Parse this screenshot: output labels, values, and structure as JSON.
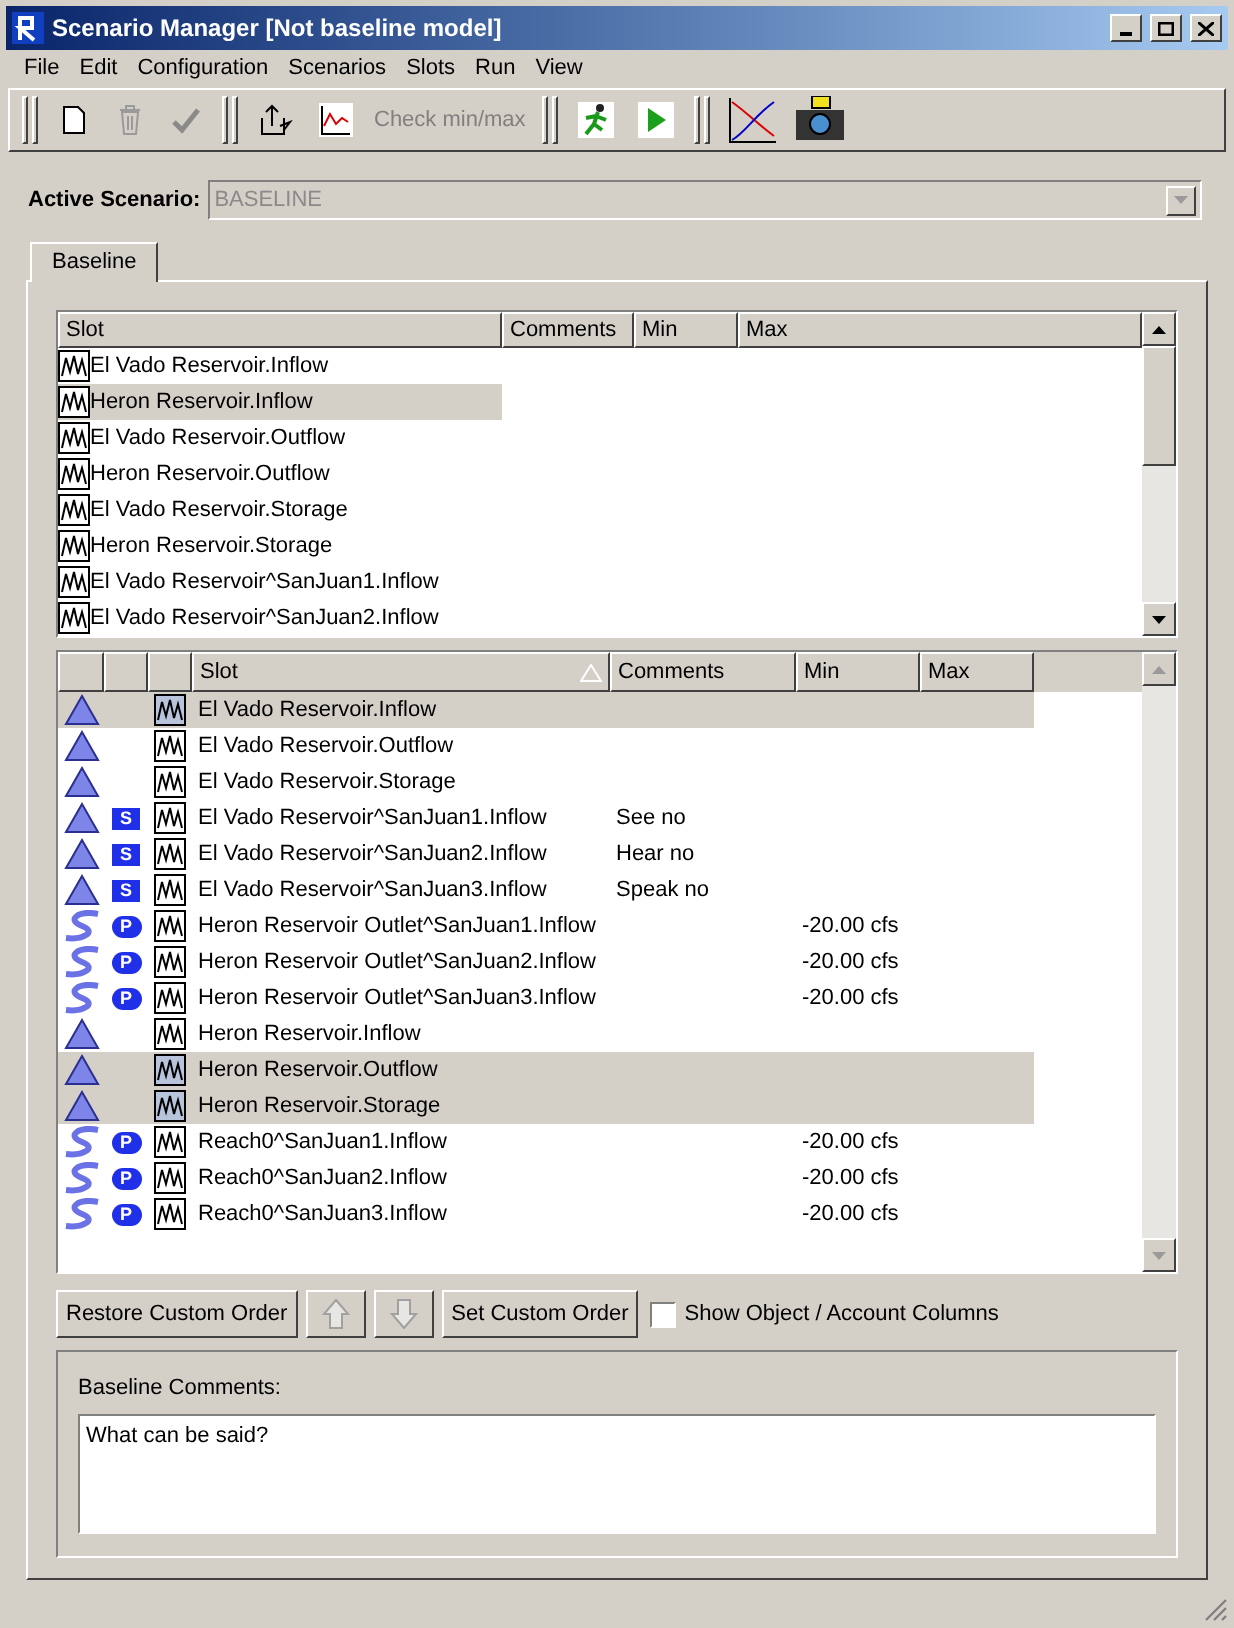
{
  "window": {
    "title": "Scenario Manager [Not baseline model]"
  },
  "menu": [
    "File",
    "Edit",
    "Configuration",
    "Scenarios",
    "Slots",
    "Run",
    "View"
  ],
  "toolbar": {
    "check_minmax": {
      "label": "Check min/max",
      "disabled": true
    }
  },
  "active_scenario": {
    "label": "Active Scenario:",
    "value": "BASELINE",
    "disabled": true
  },
  "tabs": [
    {
      "label": "Baseline",
      "selected": true
    }
  ],
  "top_table": {
    "columns": [
      "Slot",
      "Comments",
      "Min",
      "Max"
    ],
    "rows": [
      {
        "slot": "El Vado Reservoir.Inflow",
        "selected": false
      },
      {
        "slot": "Heron Reservoir.Inflow",
        "selected": true
      },
      {
        "slot": "El Vado Reservoir.Outflow",
        "selected": false
      },
      {
        "slot": "Heron Reservoir.Outflow",
        "selected": false
      },
      {
        "slot": "El Vado Reservoir.Storage",
        "selected": false
      },
      {
        "slot": "Heron Reservoir.Storage",
        "selected": false
      },
      {
        "slot": "El Vado Reservoir^SanJuan1.Inflow",
        "selected": false
      },
      {
        "slot": "El Vado Reservoir^SanJuan2.Inflow",
        "selected": false
      }
    ]
  },
  "bottom_table": {
    "columns": [
      "Slot",
      "Comments",
      "Min",
      "Max"
    ],
    "rows": [
      {
        "kind": "reservoir",
        "slot": "El Vado Reservoir.Inflow",
        "selected": true
      },
      {
        "kind": "reservoir",
        "slot": "El Vado Reservoir.Outflow",
        "selected": false
      },
      {
        "kind": "reservoir",
        "slot": "El Vado Reservoir.Storage",
        "selected": false
      },
      {
        "kind": "reservoir",
        "badge": "S",
        "slot": "El Vado Reservoir^SanJuan1.Inflow",
        "comments": "See no",
        "selected": false
      },
      {
        "kind": "reservoir",
        "badge": "S",
        "slot": "El Vado Reservoir^SanJuan2.Inflow",
        "comments": "Hear no",
        "selected": false
      },
      {
        "kind": "reservoir",
        "badge": "S",
        "slot": "El Vado Reservoir^SanJuan3.Inflow",
        "comments": "Speak no",
        "selected": false
      },
      {
        "kind": "reach",
        "badge": "P",
        "slot": "Heron Reservoir Outlet^SanJuan1.Inflow",
        "min": "-20.00 cfs",
        "selected": false
      },
      {
        "kind": "reach",
        "badge": "P",
        "slot": "Heron Reservoir Outlet^SanJuan2.Inflow",
        "min": "-20.00 cfs",
        "selected": false
      },
      {
        "kind": "reach",
        "badge": "P",
        "slot": "Heron Reservoir Outlet^SanJuan3.Inflow",
        "min": "-20.00 cfs",
        "selected": false
      },
      {
        "kind": "reservoir",
        "slot": "Heron Reservoir.Inflow",
        "selected": false
      },
      {
        "kind": "reservoir",
        "slot": "Heron Reservoir.Outflow",
        "selected": true
      },
      {
        "kind": "reservoir",
        "slot": "Heron Reservoir.Storage",
        "selected": true
      },
      {
        "kind": "reach",
        "badge": "P",
        "slot": "Reach0^SanJuan1.Inflow",
        "min": "-20.00 cfs",
        "selected": false
      },
      {
        "kind": "reach",
        "badge": "P",
        "slot": "Reach0^SanJuan2.Inflow",
        "min": "-20.00 cfs",
        "selected": false
      },
      {
        "kind": "reach",
        "badge": "P",
        "slot": "Reach0^SanJuan3.Inflow",
        "min": "-20.00 cfs",
        "selected": false
      }
    ]
  },
  "order_buttons": [
    {
      "kind": "text",
      "label": "Restore Custom Order",
      "disabled": false
    },
    {
      "kind": "up",
      "disabled": true
    },
    {
      "kind": "down",
      "disabled": true
    },
    {
      "kind": "text",
      "label": "Set Custom Order",
      "disabled": false
    }
  ],
  "show_columns": {
    "label": "Show Object / Account Columns",
    "checked": false
  },
  "comments": {
    "label": "Baseline Comments:",
    "value": "What can be said?"
  }
}
